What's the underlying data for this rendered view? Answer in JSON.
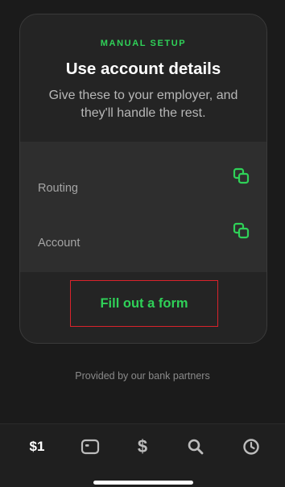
{
  "card": {
    "eyebrow": "MANUAL SETUP",
    "title": "Use account details",
    "subtitle": "Give these to your employer, and they'll handle the rest.",
    "rows": [
      {
        "label": "Routing",
        "icon": "copy-icon"
      },
      {
        "label": "Account",
        "icon": "copy-icon"
      }
    ],
    "form_button": "Fill out a form"
  },
  "footer_note": "Provided by our bank partners",
  "tabbar": {
    "balance_label": "$1",
    "card_icon": "card-icon",
    "dollar_label": "$",
    "search_icon": "search-icon",
    "activity_icon": "clock-icon"
  },
  "colors": {
    "accent": "#2fd158",
    "highlight_border": "#d9232c",
    "background": "#1b1b1b"
  }
}
